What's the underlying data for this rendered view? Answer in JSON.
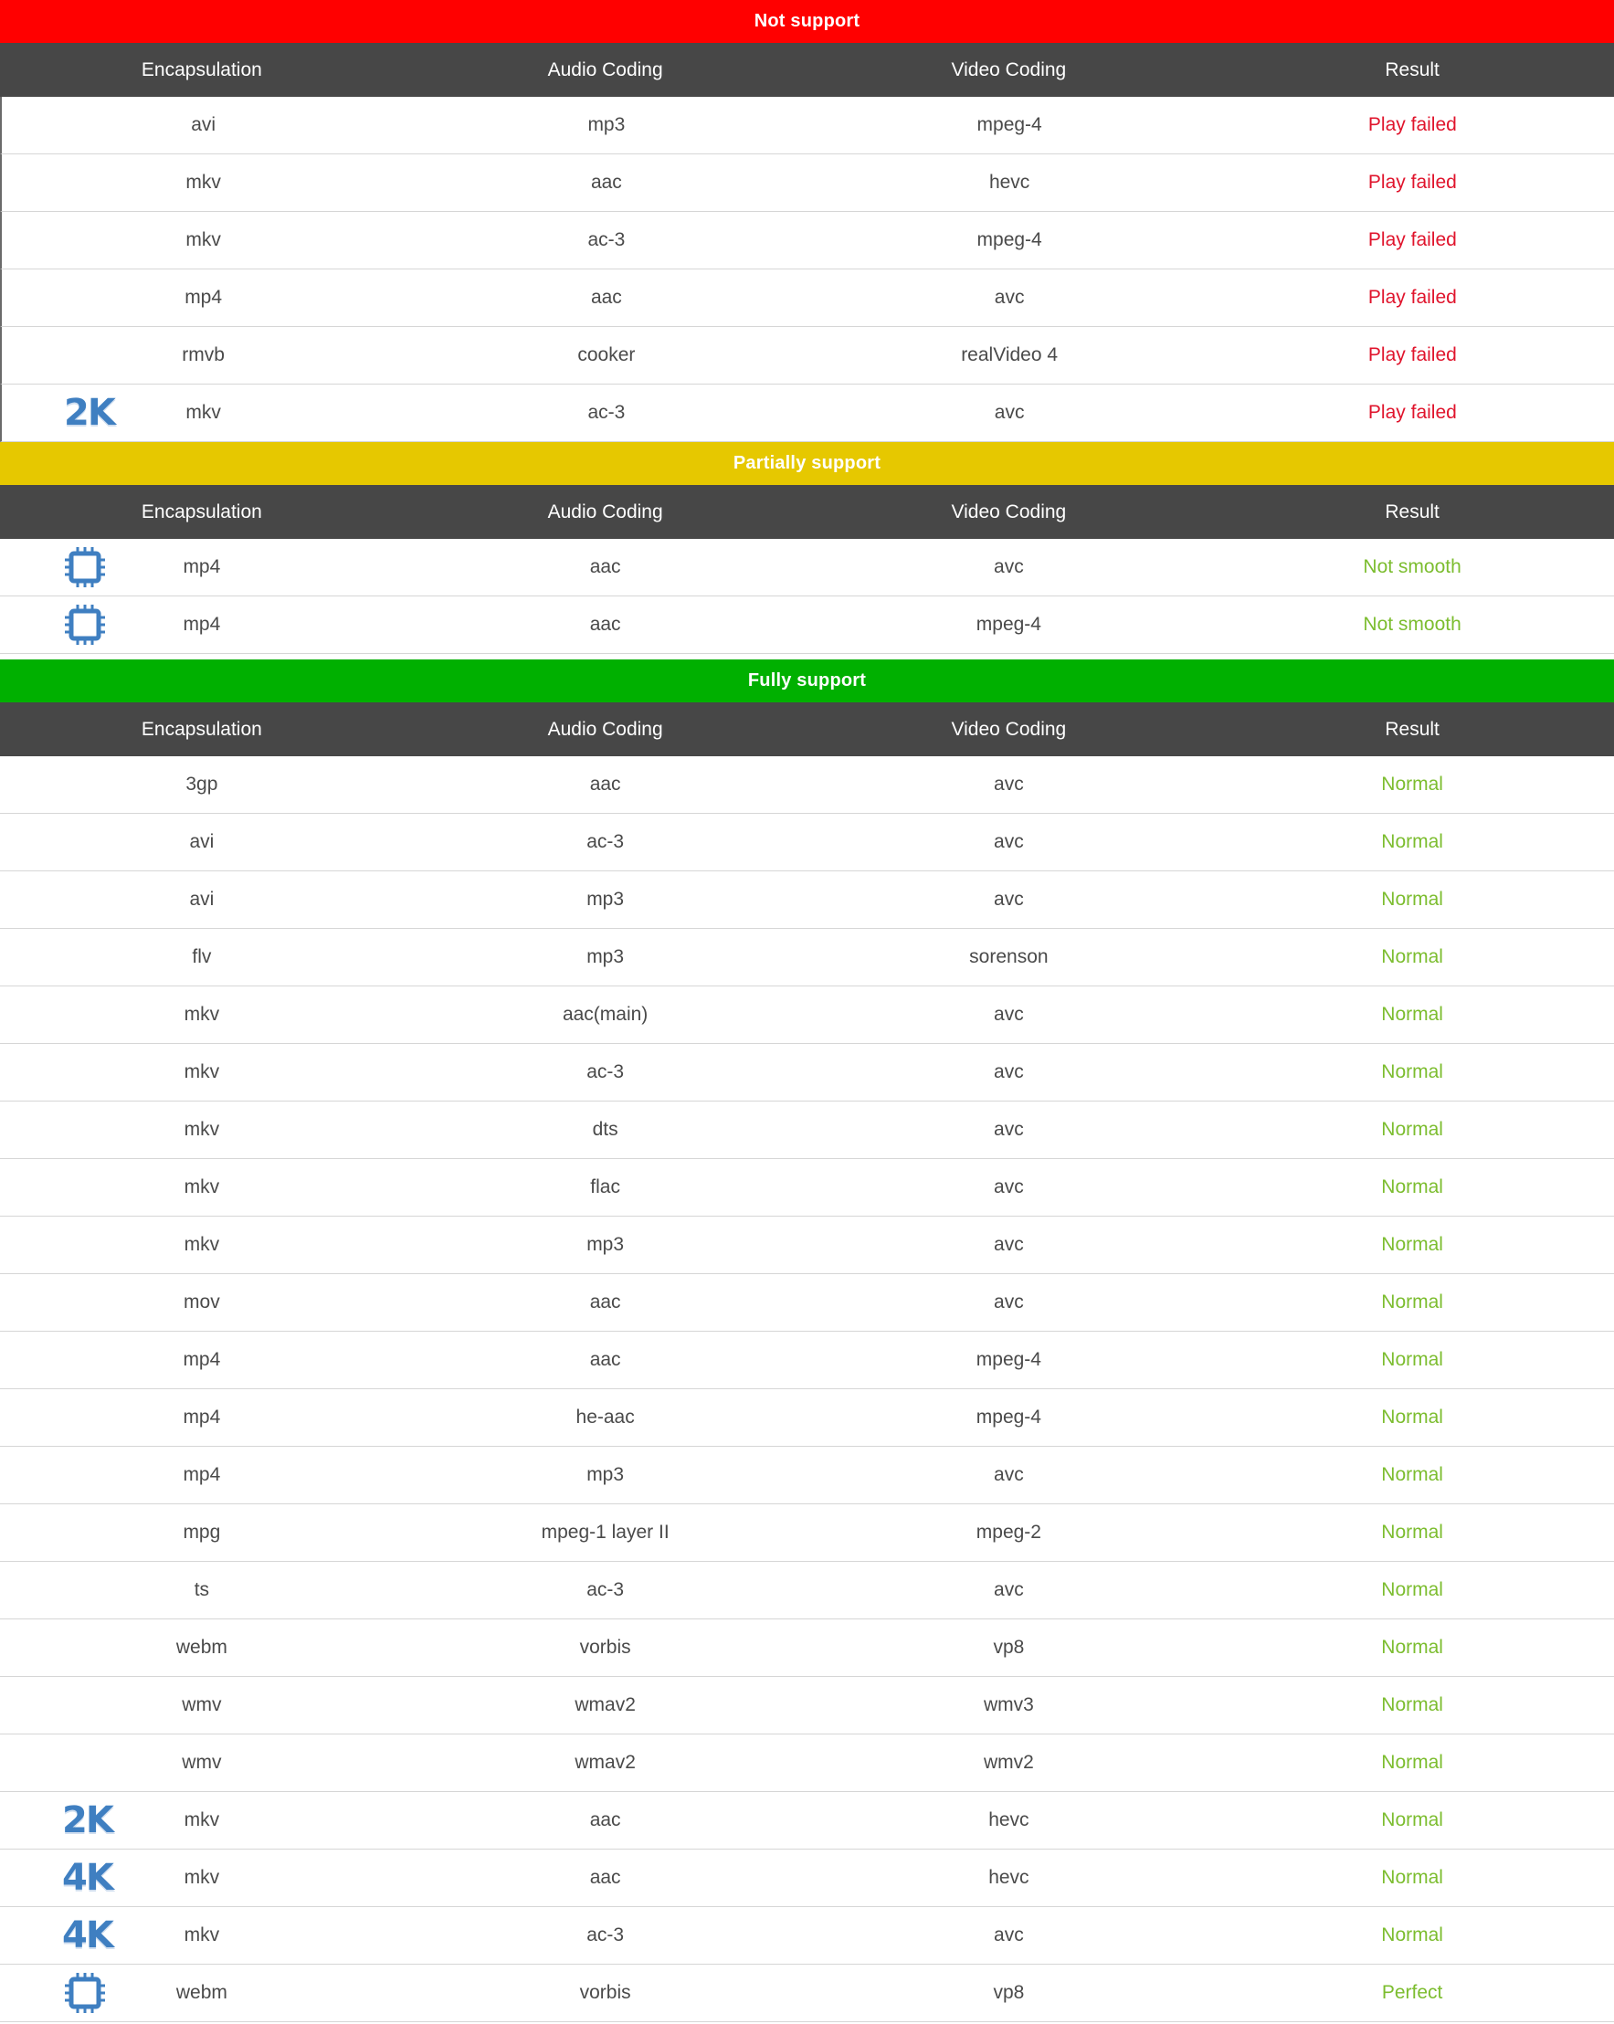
{
  "columns": [
    "Encapsulation",
    "Audio Coding",
    "Video Coding",
    "Result"
  ],
  "colors": {
    "not_support": "#ff0000",
    "partially_support": "#e6c800",
    "fully_support": "#00b000",
    "header_bg": "#474747",
    "fail_text": "#e0142c",
    "ok_text": "#7cbd2f",
    "badge": "#3f7fc1"
  },
  "sections": [
    {
      "key": "not",
      "title": "Not support",
      "rows": [
        {
          "enc": "avi",
          "audio": "mp3",
          "video": "mpeg-4",
          "result": "Play failed",
          "badge": ""
        },
        {
          "enc": "mkv",
          "audio": "aac",
          "video": "hevc",
          "result": "Play failed",
          "badge": ""
        },
        {
          "enc": "mkv",
          "audio": "ac-3",
          "video": "mpeg-4",
          "result": "Play failed",
          "badge": ""
        },
        {
          "enc": "mp4",
          "audio": "aac",
          "video": "avc",
          "result": "Play failed",
          "badge": ""
        },
        {
          "enc": "rmvb",
          "audio": "cooker",
          "video": "realVideo 4",
          "result": "Play failed",
          "badge": ""
        },
        {
          "enc": "mkv",
          "audio": "ac-3",
          "video": "avc",
          "result": "Play failed",
          "badge": "2K"
        }
      ]
    },
    {
      "key": "partial",
      "title": "Partially support",
      "rows": [
        {
          "enc": "mp4",
          "audio": "aac",
          "video": "avc",
          "result": "Not smooth",
          "badge": "chip"
        },
        {
          "enc": "mp4",
          "audio": "aac",
          "video": "mpeg-4",
          "result": "Not smooth",
          "badge": "chip"
        }
      ]
    },
    {
      "key": "full",
      "title": "Fully support",
      "rows": [
        {
          "enc": "3gp",
          "audio": "aac",
          "video": "avc",
          "result": "Normal",
          "badge": ""
        },
        {
          "enc": "avi",
          "audio": "ac-3",
          "video": "avc",
          "result": "Normal",
          "badge": ""
        },
        {
          "enc": "avi",
          "audio": "mp3",
          "video": "avc",
          "result": "Normal",
          "badge": ""
        },
        {
          "enc": "flv",
          "audio": "mp3",
          "video": "sorenson",
          "result": "Normal",
          "badge": ""
        },
        {
          "enc": "mkv",
          "audio": "aac(main)",
          "video": "avc",
          "result": "Normal",
          "badge": ""
        },
        {
          "enc": "mkv",
          "audio": "ac-3",
          "video": "avc",
          "result": "Normal",
          "badge": ""
        },
        {
          "enc": "mkv",
          "audio": "dts",
          "video": "avc",
          "result": "Normal",
          "badge": ""
        },
        {
          "enc": "mkv",
          "audio": "flac",
          "video": "avc",
          "result": "Normal",
          "badge": ""
        },
        {
          "enc": "mkv",
          "audio": "mp3",
          "video": "avc",
          "result": "Normal",
          "badge": ""
        },
        {
          "enc": "mov",
          "audio": "aac",
          "video": "avc",
          "result": "Normal",
          "badge": ""
        },
        {
          "enc": "mp4",
          "audio": "aac",
          "video": "mpeg-4",
          "result": "Normal",
          "badge": ""
        },
        {
          "enc": "mp4",
          "audio": "he-aac",
          "video": "mpeg-4",
          "result": "Normal",
          "badge": ""
        },
        {
          "enc": "mp4",
          "audio": "mp3",
          "video": "avc",
          "result": "Normal",
          "badge": ""
        },
        {
          "enc": "mpg",
          "audio": "mpeg-1 layer II",
          "video": "mpeg-2",
          "result": "Normal",
          "badge": ""
        },
        {
          "enc": "ts",
          "audio": "ac-3",
          "video": "avc",
          "result": "Normal",
          "badge": ""
        },
        {
          "enc": "webm",
          "audio": "vorbis",
          "video": "vp8",
          "result": "Normal",
          "badge": ""
        },
        {
          "enc": "wmv",
          "audio": "wmav2",
          "video": "wmv3",
          "result": "Normal",
          "badge": ""
        },
        {
          "enc": "wmv",
          "audio": "wmav2",
          "video": "wmv2",
          "result": "Normal",
          "badge": ""
        },
        {
          "enc": "mkv",
          "audio": "aac",
          "video": "hevc",
          "result": "Normal",
          "badge": "2K"
        },
        {
          "enc": "mkv",
          "audio": "aac",
          "video": "hevc",
          "result": "Normal",
          "badge": "4K"
        },
        {
          "enc": "mkv",
          "audio": "ac-3",
          "video": "avc",
          "result": "Normal",
          "badge": "4K"
        },
        {
          "enc": "webm",
          "audio": "vorbis",
          "video": "vp8",
          "result": "Perfect",
          "badge": "chip"
        }
      ]
    }
  ]
}
